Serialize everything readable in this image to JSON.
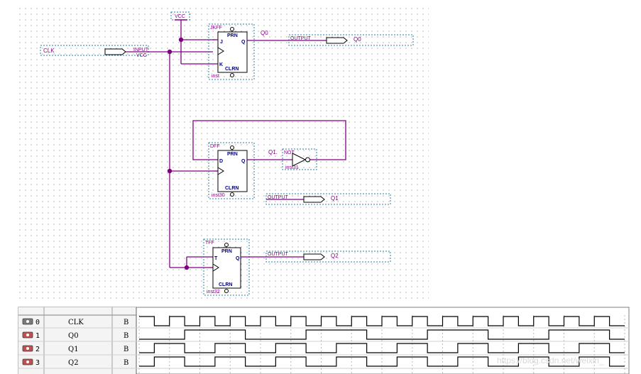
{
  "schematic": {
    "vcc_label": "VCC",
    "clk": {
      "name": "CLK",
      "type": "INPUT",
      "sub": "VCC"
    },
    "jkff": {
      "type": "JKFF",
      "inst": "inst",
      "pins": {
        "prn": "PRN",
        "j": "J",
        "k": "K",
        "q": "Q",
        "clrn": "CLRN"
      },
      "net_label": "Q0",
      "output": {
        "type": "OUTPUT",
        "name": "Q0"
      }
    },
    "dff": {
      "type": "DFF",
      "inst": "inst30",
      "pins": {
        "prn": "PRN",
        "d": "D",
        "q": "Q",
        "clrn": "CLRN"
      },
      "net_label": "Q1.",
      "not_gate": {
        "type": "NOT",
        "inst": "inst31"
      },
      "output": {
        "type": "OUTPUT",
        "name": "Q1"
      }
    },
    "tff": {
      "type": "TFF",
      "inst": "inst32",
      "pins": {
        "prn": "PRN",
        "t": "T",
        "q": "Q",
        "clrn": "CLRN"
      },
      "output": {
        "type": "OUTPUT",
        "name": "Q2"
      }
    }
  },
  "simulation": {
    "rows": [
      {
        "index": "0",
        "name": "CLK",
        "value": "B",
        "icon": "input-pin-icon",
        "levels": [
          1,
          0,
          1,
          0,
          1,
          0,
          1,
          0,
          1,
          0,
          1,
          0,
          1,
          0,
          1,
          0,
          1,
          0,
          1,
          0,
          1,
          0,
          1,
          0,
          1,
          0,
          1,
          0,
          1,
          0,
          1,
          0
        ]
      },
      {
        "index": "1",
        "name": "Q0",
        "value": "B",
        "icon": "output-pin-icon",
        "levels": [
          0,
          0,
          0,
          1,
          1,
          1,
          1,
          0,
          0,
          0,
          0,
          1,
          1,
          1,
          1,
          0,
          0,
          0,
          0,
          1,
          1,
          1,
          1,
          0,
          0,
          0,
          0,
          1,
          1,
          1,
          1,
          0
        ]
      },
      {
        "index": "2",
        "name": "Q1",
        "value": "B",
        "icon": "output-pin-icon",
        "levels": [
          0,
          1,
          1,
          0,
          0,
          1,
          1,
          0,
          0,
          1,
          1,
          0,
          0,
          1,
          1,
          0,
          0,
          1,
          1,
          0,
          0,
          1,
          1,
          0,
          0,
          1,
          1,
          0,
          0,
          1,
          1,
          0
        ]
      },
      {
        "index": "3",
        "name": "Q2",
        "value": "B",
        "icon": "output-pin-icon",
        "levels": [
          0,
          1,
          1,
          0,
          0,
          1,
          1,
          0,
          0,
          1,
          1,
          0,
          0,
          1,
          1,
          0,
          0,
          1,
          1,
          0,
          0,
          1,
          1,
          0,
          0,
          1,
          1,
          0,
          0,
          1,
          1,
          0
        ]
      }
    ],
    "watermark": "https://blog.csdn.net/weixin_"
  }
}
